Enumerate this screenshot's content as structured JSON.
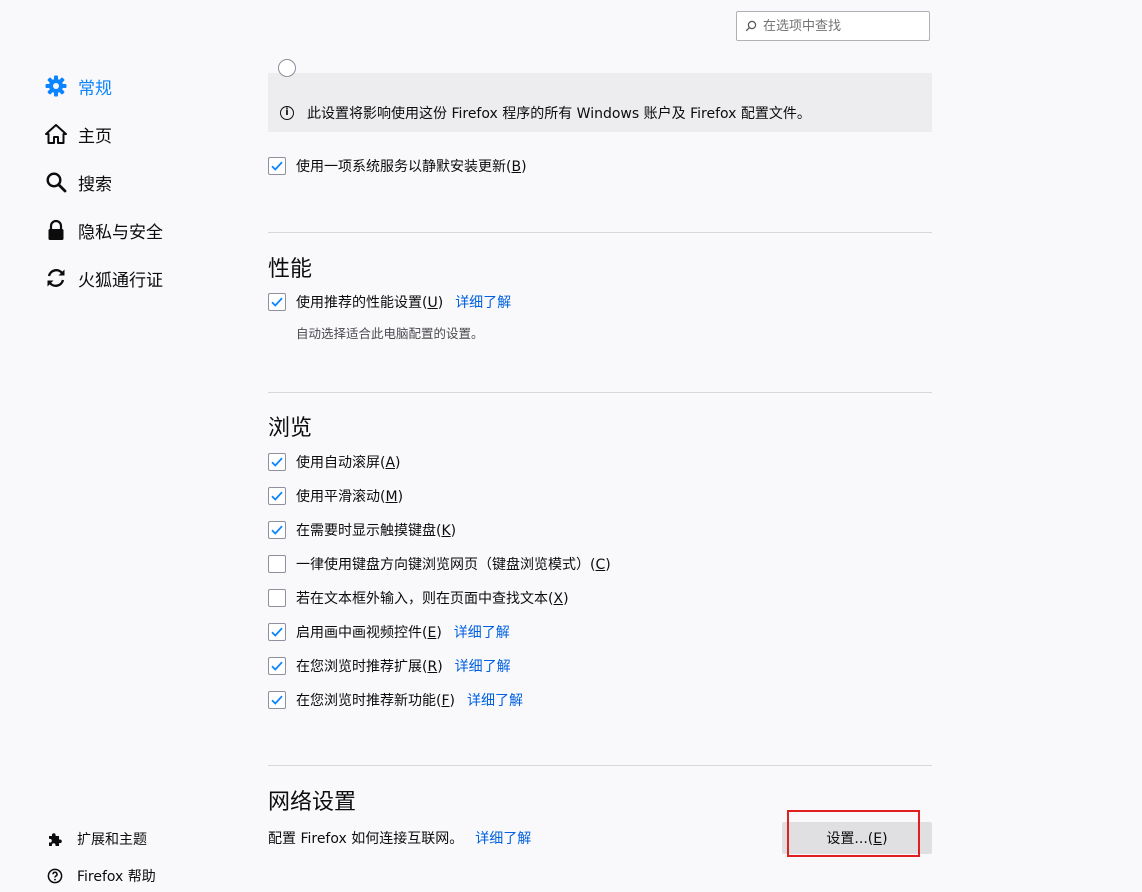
{
  "search": {
    "placeholder": "在选项中查找"
  },
  "sidebar": {
    "items": [
      {
        "label": "常规",
        "icon": "gear-icon",
        "selected": true
      },
      {
        "label": "主页",
        "icon": "home-icon",
        "selected": false
      },
      {
        "label": "搜索",
        "icon": "search-icon",
        "selected": false
      },
      {
        "label": "隐私与安全",
        "icon": "lock-icon",
        "selected": false
      },
      {
        "label": "火狐通行证",
        "icon": "sync-icon",
        "selected": false
      }
    ],
    "footer": [
      {
        "label": "扩展和主题",
        "icon": "puzzle-icon"
      },
      {
        "label": "Firefox 帮助",
        "icon": "help-icon"
      }
    ]
  },
  "updates": {
    "info_text": "此设置将影响使用这份 Firefox 程序的所有 Windows 账户及 Firefox 配置文件。",
    "background_service": {
      "label": "使用一项系统服务以静默安装更新",
      "key": "B",
      "checked": true
    }
  },
  "performance": {
    "title": "性能",
    "recommended": {
      "label": "使用推荐的性能设置",
      "key": "U",
      "checked": true,
      "link": "详细了解"
    },
    "hint": "自动选择适合此电脑配置的设置。"
  },
  "browsing": {
    "title": "浏览",
    "options": [
      {
        "label": "使用自动滚屏",
        "key": "A",
        "checked": true,
        "link": ""
      },
      {
        "label": "使用平滑滚动",
        "key": "M",
        "checked": true,
        "link": ""
      },
      {
        "label": "在需要时显示触摸键盘",
        "key": "K",
        "checked": true,
        "link": ""
      },
      {
        "label": "一律使用键盘方向键浏览网页（键盘浏览模式）",
        "key": "C",
        "checked": false,
        "link": ""
      },
      {
        "label": "若在文本框外输入，则在页面中查找文本",
        "key": "X",
        "checked": false,
        "link": ""
      },
      {
        "label": "启用画中画视频控件",
        "key": "E",
        "checked": true,
        "link": "详细了解"
      },
      {
        "label": "在您浏览时推荐扩展",
        "key": "R",
        "checked": true,
        "link": "详细了解"
      },
      {
        "label": "在您浏览时推荐新功能",
        "key": "F",
        "checked": true,
        "link": "详细了解"
      }
    ]
  },
  "network": {
    "title": "网络设置",
    "description": "配置 Firefox 如何连接互联网。",
    "link": "详细了解",
    "button": {
      "label": "设置...",
      "key": "E"
    }
  },
  "colors": {
    "accent": "#0a84ff",
    "link": "#0060df",
    "highlight": "#e02020"
  }
}
